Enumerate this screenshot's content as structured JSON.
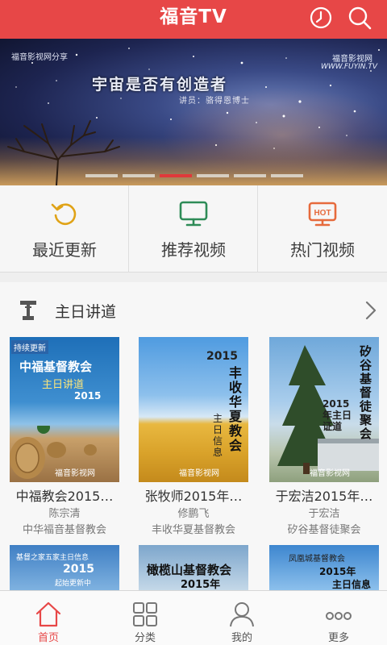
{
  "header": {
    "title": "福音TV",
    "history_icon": "clock-icon",
    "search_icon": "search-icon",
    "accent_color": "#e74747"
  },
  "banner": {
    "tag": "福音影视网分享",
    "headline": "宇宙是否有创造者",
    "speaker": "讲员：骆得恩博士",
    "watermark_cn": "福音影视网",
    "watermark_en": "WWW.FUYIN.TV",
    "slide_count": 6,
    "active_slide": 3
  },
  "quick_menu": [
    {
      "label": "最近更新",
      "icon": "refresh-icon"
    },
    {
      "label": "推荐视频",
      "icon": "monitor-icon"
    },
    {
      "label": "热门视频",
      "icon": "hot-tv-icon",
      "badge": "HOT"
    }
  ],
  "section": {
    "title": "主日讲道",
    "icon": "pulpit-icon",
    "more_icon": "chevron-right-icon",
    "cards": [
      {
        "title": "中福教会2015…",
        "author": "陈宗清",
        "church": "中华福音基督教会",
        "thumb_ribbon": "持续更新",
        "thumb_line1": "中福基督教会",
        "thumb_line2": "主日讲道",
        "thumb_year": "2015",
        "thumb_logo": "福音影视网"
      },
      {
        "title": "张牧师2015年…",
        "author": "修鹏飞",
        "church": "丰收华夏基督教会",
        "thumb_year": "2015",
        "thumb_line1": "丰收华夏教会",
        "thumb_line2": "主日信息",
        "thumb_logo": "福音影视网"
      },
      {
        "title": "于宏洁2015年…",
        "author": "于宏洁",
        "church": "矽谷基督徒聚会",
        "thumb_line1": "矽谷基督徒聚会",
        "thumb_line2": "2015年主日证道",
        "thumb_logo": "福音影视网"
      }
    ],
    "row2": [
      {
        "line1": "基督之家五家主日信息",
        "year": "2015",
        "line2": "起始更新中"
      },
      {
        "line1": "橄榄山基督教会",
        "year": "2015年"
      },
      {
        "line1": "凤凰城基督教会",
        "year": "2015年",
        "line2": "主日信息"
      }
    ]
  },
  "bottom_nav": [
    {
      "label": "首页",
      "icon": "home-icon",
      "active": true
    },
    {
      "label": "分类",
      "icon": "grid-icon",
      "active": false
    },
    {
      "label": "我的",
      "icon": "user-icon",
      "active": false
    },
    {
      "label": "更多",
      "icon": "more-icon",
      "active": false
    }
  ]
}
